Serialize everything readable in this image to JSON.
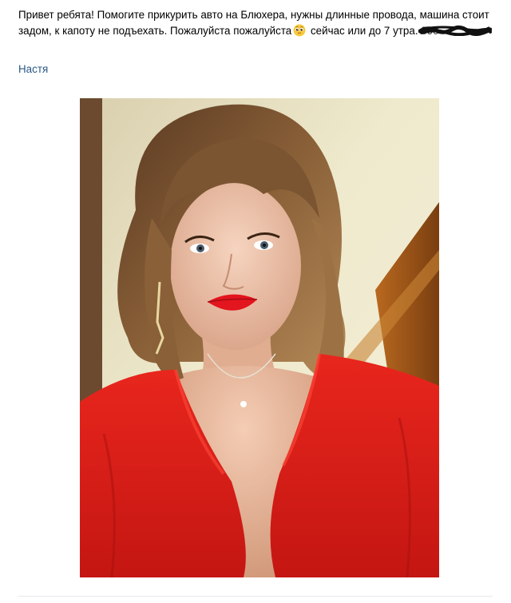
{
  "post": {
    "text_before_emoji": "Привет ребята! Помогите прикурить авто на Блюхера, нужны длинные провода, машина стоит задом, к капоту не подъехать. Пожалуйста пожалуйста",
    "text_after_emoji": " сейчас или до 7 утра. ",
    "phone_visible": "890",
    "emoji": "pleading-face-emoji",
    "author_name": "Настя",
    "photo": {
      "subject": "selfie-woman-red-dress",
      "dress_color": "#e0211b",
      "background_color": "#ece8c8"
    }
  },
  "colors": {
    "link": "#2a5885",
    "text": "#000000",
    "divider": "#e7e8ec"
  }
}
